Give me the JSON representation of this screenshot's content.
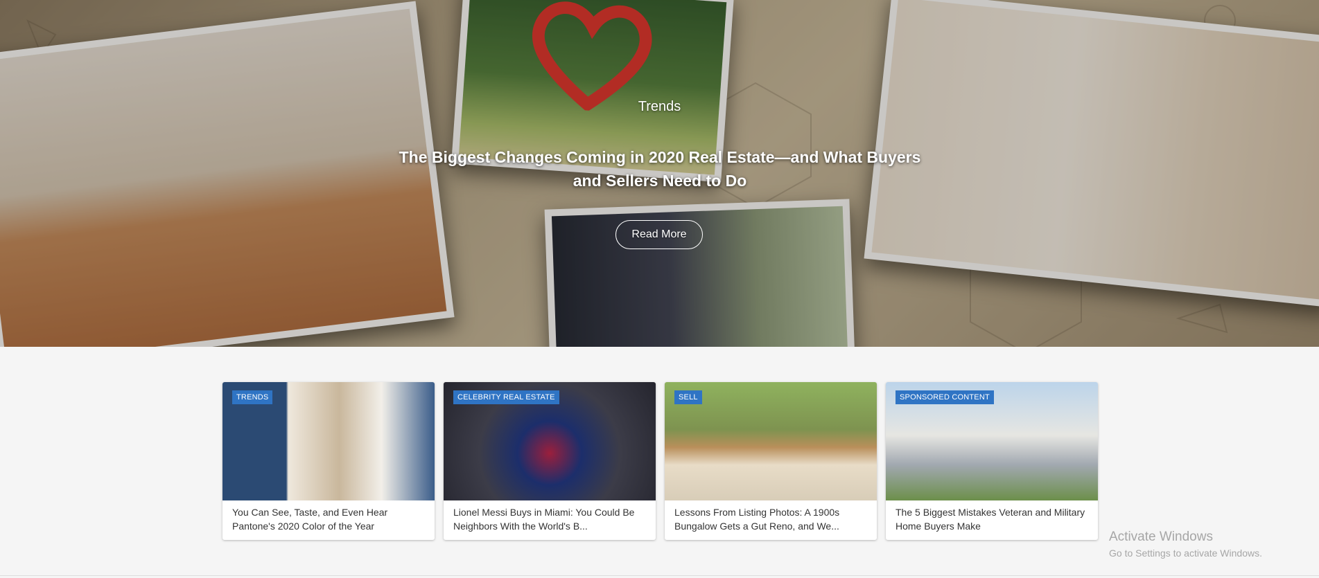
{
  "hero": {
    "category": "Trends",
    "title": "The Biggest Changes Coming in 2020 Real Estate—and What Buyers and Sellers Need to Do",
    "button_label": "Read More"
  },
  "cards": [
    {
      "badge": "TRENDS",
      "title": "You Can See, Taste, and Even Hear Pantone's 2020 Color of the Year"
    },
    {
      "badge": "CELEBRITY REAL ESTATE",
      "title": "Lionel Messi Buys in Miami: You Could Be Neighbors With the World's B..."
    },
    {
      "badge": "SELL",
      "title": "Lessons From Listing Photos: A 1900s Bungalow Gets a Gut Reno, and We..."
    },
    {
      "badge": "SPONSORED CONTENT",
      "title": "The 5 Biggest Mistakes Veteran and Military Home Buyers Make"
    }
  ],
  "watermark": {
    "title": "Activate Windows",
    "subtitle": "Go to Settings to activate Windows."
  },
  "colors": {
    "badge": "#2f74c4",
    "page_bg": "#f5f5f5"
  }
}
